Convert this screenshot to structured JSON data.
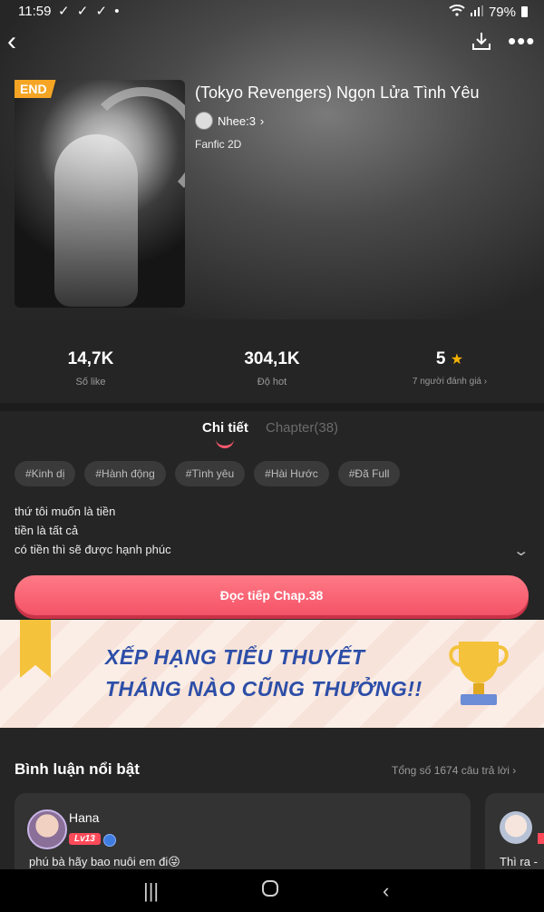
{
  "status": {
    "time": "11:59",
    "checks": "✓ ✓ ✓ •",
    "battery": "79%"
  },
  "topbar": {
    "back_icon": "chevron-left-icon",
    "download_icon": "download-icon",
    "more_icon": "more-icon"
  },
  "story": {
    "badge": "END",
    "title": "(Tokyo Revengers) Ngọn Lửa Tình Yêu",
    "author": "Nhee:3",
    "genre": "Fanfic 2D"
  },
  "stats": {
    "likes": {
      "value": "14,7K",
      "label": "Số like"
    },
    "hot": {
      "value": "304,1K",
      "label": "Độ hot"
    },
    "rating": {
      "value": "5",
      "label": "7 người đánh giá ›"
    }
  },
  "tabs": {
    "detail": "Chi tiết",
    "chapters": "Chapter(38)"
  },
  "tags": [
    "#Kinh dị",
    "#Hành động",
    "#Tình yêu",
    "#Hài Hước",
    "#Đã Full"
  ],
  "description": [
    "thứ tôi muốn là tiền",
    "tiền là tất cả",
    "có tiền thì sẽ được hạnh phúc"
  ],
  "read_button": "Đọc tiếp Chap.38",
  "banner": {
    "line1": "XẾP HẠNG TIỂU THUYẾT",
    "line2": "THÁNG NÀO CŨNG THƯỞNG!!"
  },
  "comments": {
    "heading": "Bình luận nổi bật",
    "total": "Tổng số 1674 câu trả lời ›",
    "items": [
      {
        "name": "Hana",
        "level": "Lv13",
        "text": "phú bà hãy bao nuôi em đi😜"
      },
      {
        "name": "",
        "level": "",
        "text": "Thì ra -"
      }
    ]
  },
  "colors": {
    "accent": "#f45367",
    "badge": "#f5a523",
    "star": "#f5b400"
  }
}
